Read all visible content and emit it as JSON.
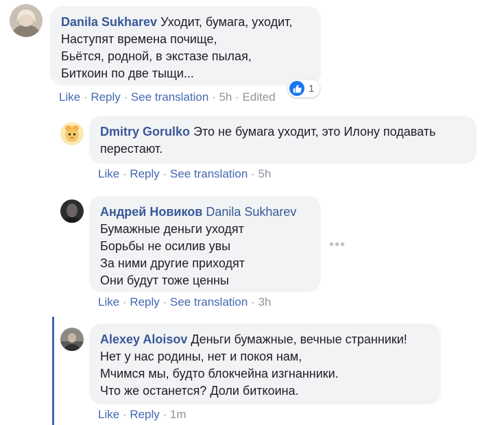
{
  "comments": [
    {
      "author": "Danila Sukharev",
      "lines": [
        "Уходит, бумага, уходит,",
        "Наступят времена почище,",
        "Бьётся, родной, в экстазе пылая,",
        "Биткоин по две тыщи..."
      ],
      "actions": {
        "like": "Like",
        "reply": "Reply",
        "translate": "See translation",
        "time": "5h",
        "edited": "Edited"
      },
      "reactions": {
        "icon": "thumbs-up-icon",
        "count": "1"
      }
    },
    {
      "author": "Dmitry Gorulko",
      "lines": [
        "Это не бумага уходит, это Илону подавать",
        "перестают."
      ],
      "actions": {
        "like": "Like",
        "reply": "Reply",
        "translate": "See translation",
        "time": "5h"
      }
    },
    {
      "author": "Андрей Новиков",
      "mention": "Danila Sukharev",
      "lines": [
        "Бумажные деньги уходят",
        "Борьбы не осилив увы",
        "За ними другие приходят",
        "Они будут тоже ценны"
      ],
      "actions": {
        "like": "Like",
        "reply": "Reply",
        "translate": "See translation",
        "time": "3h"
      },
      "more": "•••"
    },
    {
      "author": "Alexey Aloisov",
      "lines": [
        "Деньги бумажные, вечные странники!",
        "Нет у нас родины, нет и покоя нам,",
        "Мчимся мы, будто блокчейна изгнанники.",
        "Что же останется? Доли биткоина."
      ],
      "actions": {
        "like": "Like",
        "reply": "Reply",
        "time": "1m"
      }
    }
  ],
  "colors": {
    "link": "#385898",
    "action": "#4267b2",
    "bubble": "#f2f3f5",
    "muted": "#90949c",
    "highlight_bar": "#4267b2"
  }
}
